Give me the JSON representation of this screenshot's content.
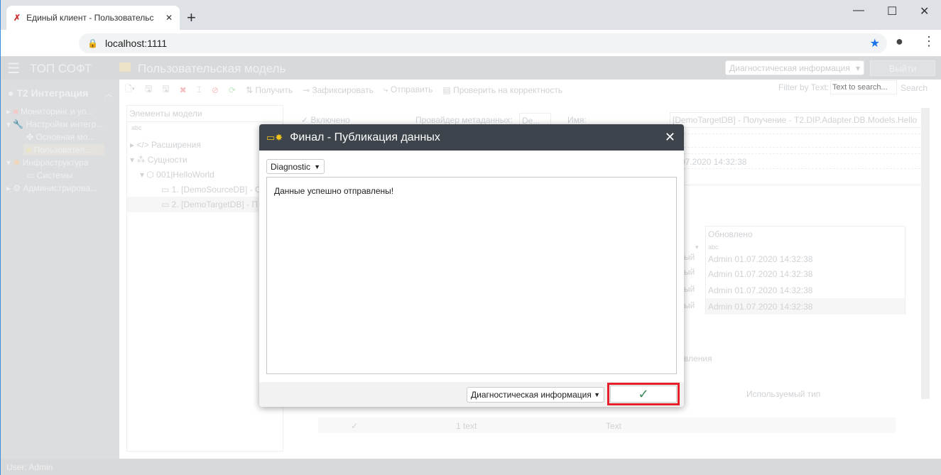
{
  "browser": {
    "tab_title": "Единый клиент - Пользовательс",
    "url": "localhost:1111"
  },
  "app": {
    "brand": "ТОП СОФТ",
    "page_title": "Пользовательская модель",
    "diag_select": "Диагностическая информация",
    "logout": "Выйти"
  },
  "sidebar": {
    "section": "Т2 Интеграция",
    "items": [
      "Мониторинг и уп...",
      "Настройки интегр...",
      "Основная мо...",
      "Пользовател...",
      "Инфраструктура",
      "Системы",
      "Администрирова..."
    ]
  },
  "toolbar": {
    "get": "Получить",
    "commit": "Зафиксировать",
    "send": "Отправить",
    "validate": "Проверить на корректность",
    "filter_label": "Filter by Text:",
    "filter_placeholder": "Text to search...",
    "search": "Search"
  },
  "tree": {
    "header": "Элементы модели",
    "nodes": [
      "Расширения",
      "Сущности",
      "001|HelloWorld",
      "1. [DemoSourceDB] - О",
      "2. [DemoTargetDB] - П"
    ]
  },
  "form": {
    "enabled": "Включено",
    "provider_label": "Провайдер метаданных:",
    "provider_value": "De...",
    "name_label": "Имя:",
    "name_value": "[DemoTargetDB] - Получение - T2.DIP.Adapter.DB.Models.Hello",
    "date": "07.2020 14:32:38"
  },
  "grid": {
    "col_updated": "Обновлено",
    "rows": [
      "Admin 01.07.2020 14:32:38",
      "Admin 01.07.2020 14:32:38",
      "Admin 01.07.2020 14:32:38",
      "Admin 01.07.2020 14:32:38"
    ],
    "partial": "ый",
    "tab_partial": "вления",
    "col_type": "Используемый тип",
    "row_num": "1",
    "row_text": "text",
    "row_type": "Text"
  },
  "dialog": {
    "title": "Финал - Публикация данных",
    "level": "Diagnostic",
    "message": "Данные успешно отправлены!",
    "footer_select": "Диагностическая информация",
    "ok": "✓"
  },
  "status": {
    "user": "User: Admin"
  },
  "colors": {
    "dialog_header": "#3d444b",
    "highlight": "#e5202a",
    "ok_check": "#3b8a5a"
  }
}
